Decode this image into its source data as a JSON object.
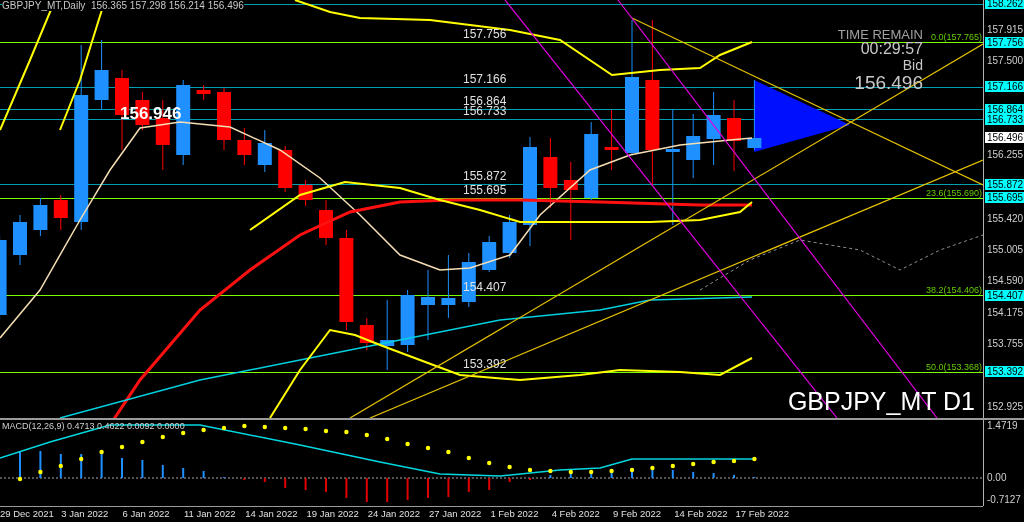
{
  "header": "GBPJPY_MT,Daily  156.365 157.298 156.214 156.496",
  "price_label": "156.946",
  "time_remain": {
    "label": "TIME REMAIN",
    "value": "00:29:57",
    "bid_label": "Bid",
    "bid": "156.496"
  },
  "chart_symbol": "GBPJPY_MT D1",
  "levels": [
    {
      "axis_label": "158.262",
      "color": "#00a0b0"
    },
    {
      "axis_label": "157.756",
      "chart_label": "157.756",
      "fib_label": "0.0(157.765)",
      "color": "#7cfc00"
    },
    {
      "axis_label": "157.166",
      "chart_label": "157.166",
      "color": "#00a0b0"
    },
    {
      "axis_label": "156.864",
      "chart_label": "156.864",
      "color": "#00a0b0"
    },
    {
      "axis_label": "156.733",
      "chart_label": "156.733",
      "color": "#00a0b0"
    },
    {
      "axis_label": "155.872",
      "chart_label": "155.872",
      "color": "#00a0b0"
    },
    {
      "axis_label": "155.695",
      "chart_label": "155.695",
      "fib_label": "23.6(155.690)",
      "color": "#7cfc00"
    },
    {
      "axis_label": "154.407",
      "chart_label": "154.407",
      "fib_label": "38.2(154.406)",
      "color": "#7cfc00"
    },
    {
      "axis_label": "153.392",
      "chart_label": "153.392",
      "fib_label": "50.0(153.368)",
      "color": "#7cfc00"
    }
  ],
  "price_axis": {
    "ticks": [
      "157.915",
      "157.500",
      "156.255",
      "155.420",
      "155.005",
      "154.590",
      "154.175",
      "153.755",
      "152.925"
    ],
    "current": "156.496"
  },
  "macd": {
    "label": "MACD(12,26,9) 0.4713 0.4622 0.0092 0.0000",
    "axis": [
      "1.4719",
      "0.00",
      "-0.7127"
    ]
  },
  "date_axis": [
    "29 Dec 2021",
    "3 Jan 2022",
    "6 Jan 2022",
    "11 Jan 2022",
    "14 Jan 2022",
    "19 Jan 2022",
    "24 Jan 2022",
    "27 Jan 2022",
    "1 Feb 2022",
    "4 Feb 2022",
    "9 Feb 2022",
    "14 Feb 2022",
    "17 Feb 2022"
  ]
}
